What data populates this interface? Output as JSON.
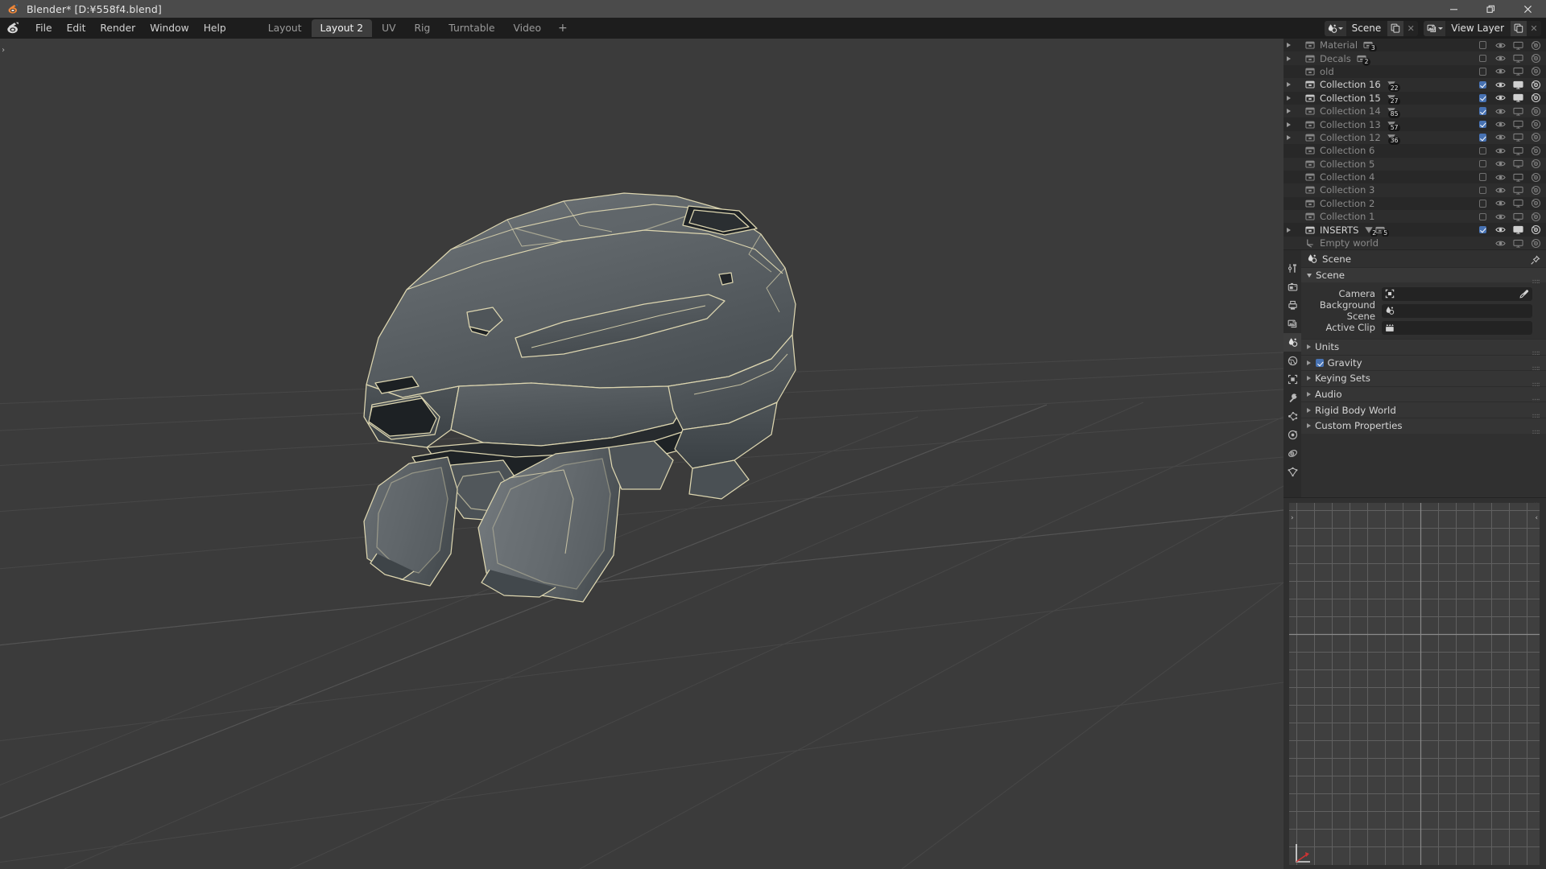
{
  "titlebar": {
    "app_title": "Blender* [D:¥558f4.blend]",
    "logo_icon": "blender-logo-icon",
    "minimize": "−",
    "restore": "❐",
    "close": "✕"
  },
  "topbar": {
    "app_menu_icon": "blender-menu-icon",
    "menus": [
      "File",
      "Edit",
      "Render",
      "Window",
      "Help"
    ],
    "workspaces": [
      {
        "label": "Layout",
        "active": false
      },
      {
        "label": "Layout 2",
        "active": true
      },
      {
        "label": "UV",
        "active": false
      },
      {
        "label": "Rig",
        "active": false
      },
      {
        "label": "Turntable",
        "active": false
      },
      {
        "label": "Video",
        "active": false
      }
    ],
    "add_workspace": "+",
    "scene_selector": {
      "icon": "scene-icon",
      "value": "Scene",
      "copy_icon": "new-scene-icon",
      "unlink": "✕"
    },
    "viewlayer_selector": {
      "icon": "view-layer-icon",
      "value": "View Layer",
      "copy_icon": "new-viewlayer-icon",
      "unlink": "✕"
    }
  },
  "viewport": {
    "sidebar_toggle": "›",
    "background_color": "#3b3b3b",
    "grid_color": "#4a4a4a",
    "object_outline_color": "#ddd6b0",
    "mesh_fill_color": "#5b6164"
  },
  "outliner": {
    "scroll_chevron": "⌄",
    "rows": [
      {
        "label": "Material",
        "expandable": true,
        "enabled": false,
        "badges": [
          {
            "icon": "mesh-data-icon",
            "count": "3"
          }
        ],
        "checkbox": false,
        "visible_dim": true
      },
      {
        "label": "Decals",
        "expandable": true,
        "enabled": false,
        "badges": [
          {
            "icon": "mesh-data-icon",
            "count": "2"
          }
        ],
        "checkbox": false,
        "visible_dim": true
      },
      {
        "label": "old",
        "expandable": false,
        "enabled": false,
        "badges": [],
        "checkbox": false,
        "visible_dim": true
      },
      {
        "label": "Collection 16",
        "expandable": true,
        "enabled": true,
        "badges": [
          {
            "icon": "mesh-tri-icon",
            "count": "22"
          }
        ],
        "checkbox": true,
        "visible_dim": false
      },
      {
        "label": "Collection 15",
        "expandable": true,
        "enabled": true,
        "badges": [
          {
            "icon": "mesh-tri-icon",
            "count": "27"
          }
        ],
        "checkbox": true,
        "visible_dim": false
      },
      {
        "label": "Collection 14",
        "expandable": true,
        "enabled": false,
        "badges": [
          {
            "icon": "mesh-tri-icon",
            "count": "85"
          }
        ],
        "checkbox": true,
        "visible_dim": true
      },
      {
        "label": "Collection 13",
        "expandable": true,
        "enabled": false,
        "badges": [
          {
            "icon": "mesh-tri-icon",
            "count": "57"
          }
        ],
        "checkbox": true,
        "visible_dim": true
      },
      {
        "label": "Collection 12",
        "expandable": true,
        "enabled": false,
        "badges": [
          {
            "icon": "mesh-tri-icon",
            "count": "36"
          }
        ],
        "checkbox": true,
        "visible_dim": true
      },
      {
        "label": "Collection 6",
        "expandable": false,
        "enabled": false,
        "badges": [],
        "checkbox": false,
        "visible_dim": true
      },
      {
        "label": "Collection 5",
        "expandable": false,
        "enabled": false,
        "badges": [],
        "checkbox": false,
        "visible_dim": true
      },
      {
        "label": "Collection 4",
        "expandable": false,
        "enabled": false,
        "badges": [],
        "checkbox": false,
        "visible_dim": true
      },
      {
        "label": "Collection 3",
        "expandable": false,
        "enabled": false,
        "badges": [],
        "checkbox": false,
        "visible_dim": true
      },
      {
        "label": "Collection 2",
        "expandable": false,
        "enabled": false,
        "badges": [],
        "checkbox": false,
        "visible_dim": true
      },
      {
        "label": "Collection 1",
        "expandable": false,
        "enabled": false,
        "badges": [],
        "checkbox": false,
        "visible_dim": true
      },
      {
        "label": "INSERTS",
        "expandable": true,
        "enabled": true,
        "badges": [
          {
            "icon": "mesh-tri-icon",
            "count": "2"
          },
          {
            "icon": "collection-icon",
            "count": "5"
          }
        ],
        "checkbox": true,
        "visible_dim": false
      },
      {
        "label": "Empty world",
        "expandable": false,
        "enabled": false,
        "badges": [],
        "checkbox": null,
        "visible_dim": true,
        "is_object": true
      }
    ],
    "toggle_icons": [
      "checkbox-exclude",
      "eye-icon",
      "monitor-icon",
      "camera-icon"
    ]
  },
  "properties": {
    "tabs": [
      {
        "name": "tool-tab",
        "icon": "tool-icon",
        "active": false
      },
      {
        "name": "render-tab",
        "icon": "camera-back-icon",
        "active": false
      },
      {
        "name": "output-tab",
        "icon": "printer-icon",
        "active": false
      },
      {
        "name": "viewlayer-tab",
        "icon": "images-icon",
        "active": false
      },
      {
        "name": "scene-tab",
        "icon": "scene-icon",
        "active": true
      },
      {
        "name": "world-tab",
        "icon": "world-icon",
        "active": false
      },
      {
        "name": "object-tab",
        "icon": "object-icon",
        "active": false
      },
      {
        "name": "modifier-tab",
        "icon": "wrench-icon",
        "active": false
      },
      {
        "name": "particles-tab",
        "icon": "particles-icon",
        "active": false
      },
      {
        "name": "physics-tab",
        "icon": "physics-icon",
        "active": false
      },
      {
        "name": "constraints-tab",
        "icon": "constraint-icon",
        "active": false
      },
      {
        "name": "data-tab",
        "icon": "mesh-data-icon",
        "active": false
      }
    ],
    "breadcrumb": {
      "icon": "scene-icon",
      "label": "Scene"
    },
    "pin_icon": "pin-icon",
    "scene_panel": {
      "title": "Scene",
      "fields": [
        {
          "label": "Camera",
          "icon": "camera-object-icon",
          "value": "",
          "has_eyedropper": true
        },
        {
          "label": "Background Scene",
          "icon": "scene-icon",
          "value": "",
          "has_eyedropper": false
        },
        {
          "label": "Active Clip",
          "icon": "clip-icon",
          "value": "",
          "has_eyedropper": false
        }
      ]
    },
    "closed_panels": [
      {
        "label": "Units",
        "checkbox": null
      },
      {
        "label": "Gravity",
        "checkbox": true
      },
      {
        "label": "Keying Sets",
        "checkbox": null
      },
      {
        "label": "Audio",
        "checkbox": null
      },
      {
        "label": "Rigid Body World",
        "checkbox": null
      },
      {
        "label": "Custom Properties",
        "checkbox": null
      }
    ]
  },
  "bottom_editor": {
    "left_arrow": "›",
    "right_arrow": "‹",
    "chevron": "⌄",
    "grid_color": "#6b6b6b",
    "background_color": "#3f3f3f",
    "gizmo": {
      "x_axis_color": "#cc3333",
      "y_axis_color": "#ffffff"
    }
  }
}
